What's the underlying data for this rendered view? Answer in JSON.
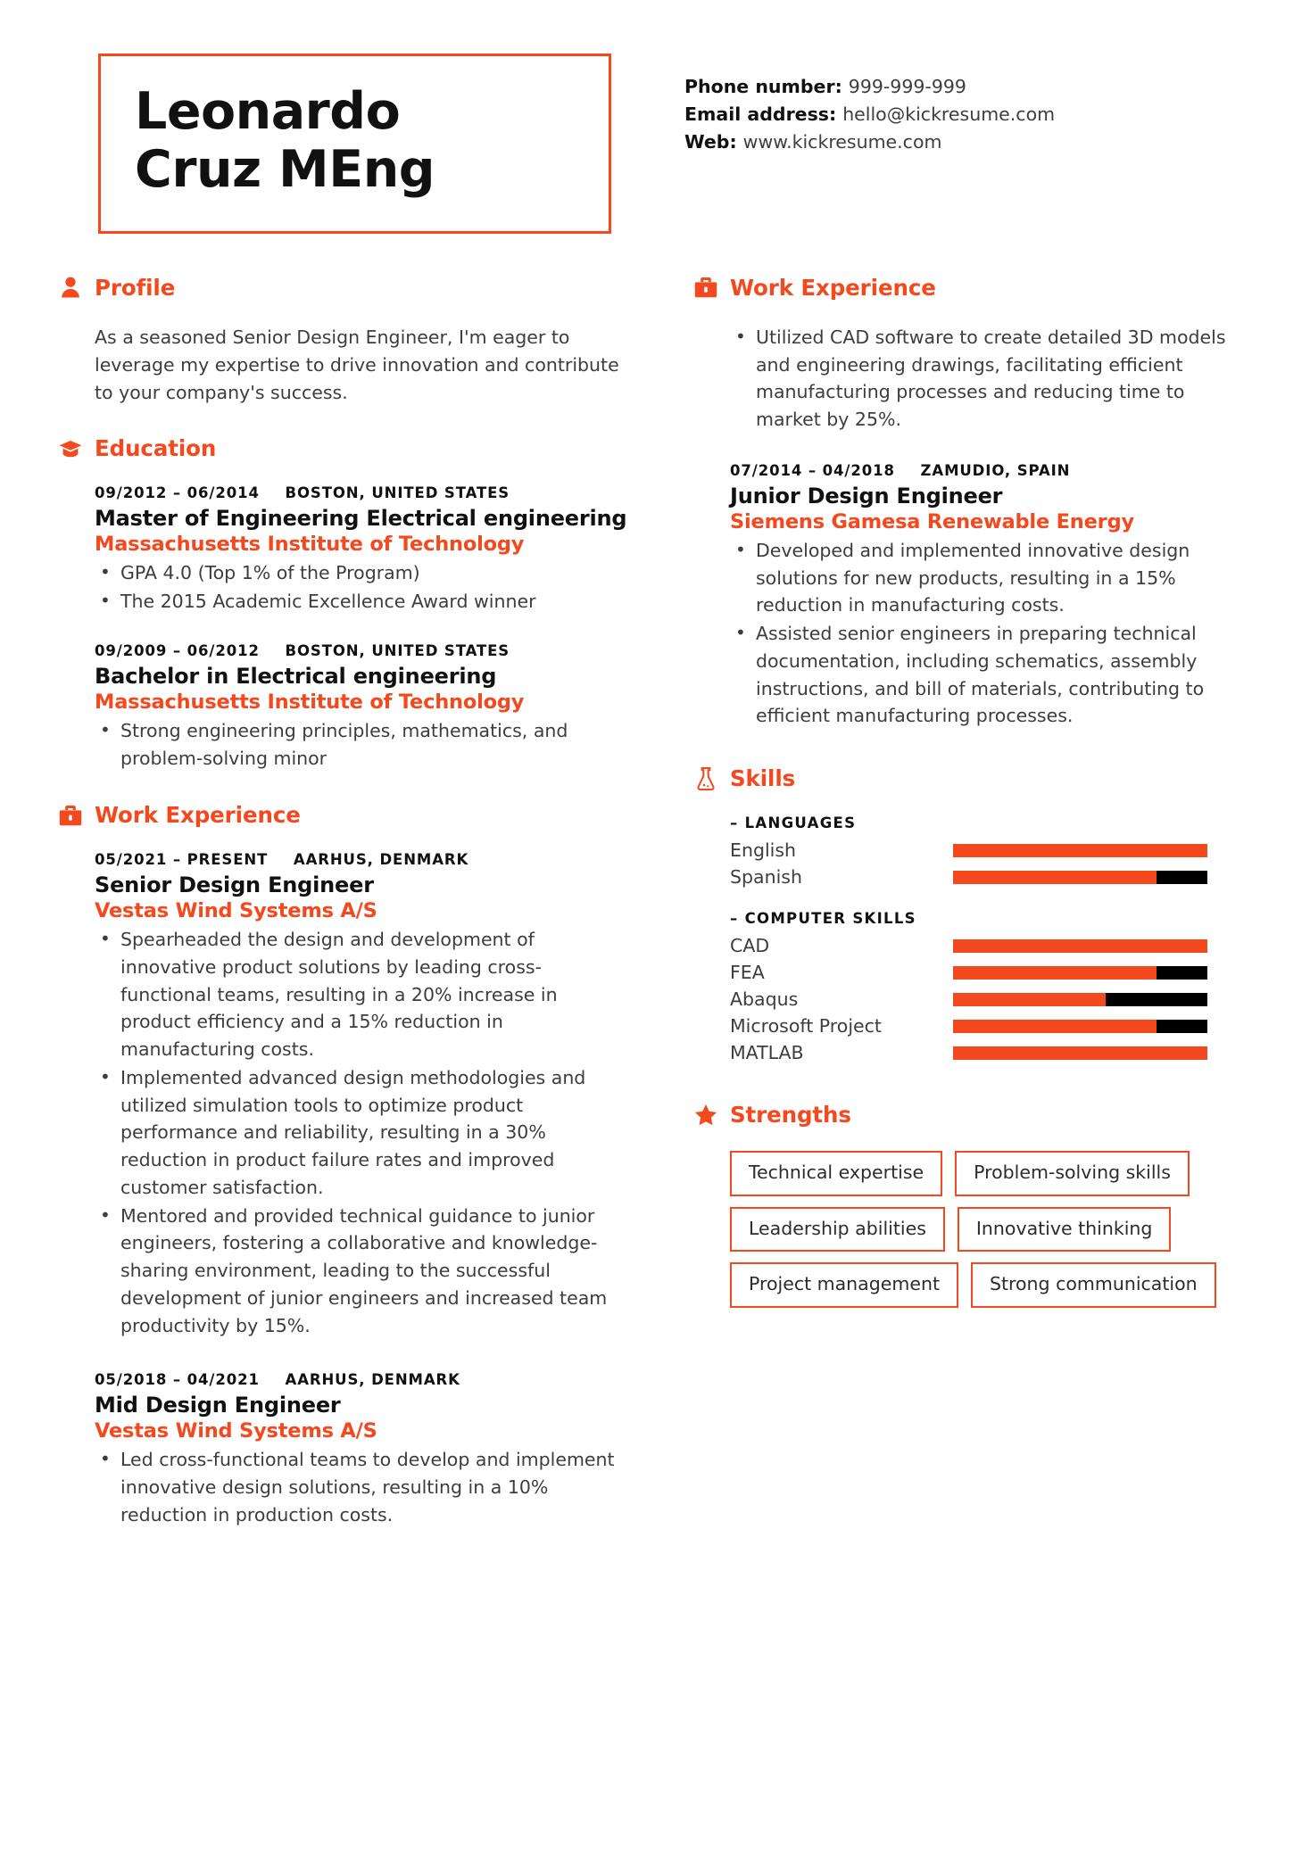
{
  "theme": {
    "accent": "#F4481E",
    "ink": "#111111",
    "body_text": "#3d3d3d",
    "bar_track": "#000000"
  },
  "header": {
    "name_line_1": "Leonardo",
    "name_line_2": "Cruz MEng",
    "contact": [
      {
        "label": "Phone number:",
        "value": "999-999-999"
      },
      {
        "label": "Email address:",
        "value": "hello@kickresume.com"
      },
      {
        "label": "Web:",
        "value": "www.kickresume.com"
      }
    ]
  },
  "left": {
    "profile": {
      "icon": "person-icon",
      "title": "Profile",
      "text": "As a seasoned Senior Design Engineer, I'm eager to leverage my expertise to drive innovation and contribute to your company's success."
    },
    "education": {
      "icon": "graduation-cap-icon",
      "title": "Education",
      "entries": [
        {
          "dates": "09/2012 – 06/2014",
          "location": "BOSTON, UNITED STATES",
          "title": "Master of Engineering Electrical engineering",
          "org": "Massachusetts Institute of Technology",
          "bullets": [
            "GPA 4.0 (Top 1% of the Program)",
            "The 2015 Academic Excellence Award winner"
          ]
        },
        {
          "dates": "09/2009 – 06/2012",
          "location": "BOSTON, UNITED STATES",
          "title": "Bachelor in Electrical engineering",
          "org": "Massachusetts Institute of Technology",
          "bullets": [
            "Strong engineering principles, mathematics, and problem-solving minor"
          ]
        }
      ]
    },
    "work": {
      "icon": "briefcase-icon",
      "title": "Work Experience",
      "entries": [
        {
          "dates": "05/2021 – PRESENT",
          "location": "AARHUS, DENMARK",
          "title": "Senior Design Engineer",
          "org": "Vestas Wind Systems A/S",
          "bullets": [
            "Spearheaded the design and development of innovative product solutions by leading cross-functional teams, resulting in a 20% increase in product efficiency and a 15% reduction in manufacturing costs.",
            "Implemented advanced design methodologies and utilized simulation tools to optimize product performance and reliability, resulting in a 30% reduction in product failure rates and improved customer satisfaction.",
            "Mentored and provided technical guidance to junior engineers, fostering a collaborative and knowledge-sharing environment, leading to the successful development of junior engineers and increased team productivity by 15%."
          ]
        },
        {
          "dates": "05/2018 – 04/2021",
          "location": "AARHUS, DENMARK",
          "title": "Mid Design Engineer",
          "org": "Vestas Wind Systems A/S",
          "bullets": [
            "Led cross-functional teams to develop and implement innovative design solutions, resulting in a 10% reduction in production costs."
          ]
        }
      ]
    }
  },
  "right": {
    "work": {
      "icon": "briefcase-icon",
      "title": "Work Experience",
      "lead_bullets": [
        "Utilized CAD software to create detailed 3D models and engineering drawings, facilitating efficient manufacturing processes and reducing time to market by 25%."
      ],
      "entries": [
        {
          "dates": "07/2014 – 04/2018",
          "location": "ZAMUDIO, SPAIN",
          "title": "Junior Design Engineer",
          "org": "Siemens Gamesa Renewable Energy",
          "bullets": [
            "Developed and implemented innovative design solutions for new products, resulting in a 15% reduction in manufacturing costs.",
            "Assisted senior engineers in preparing technical documentation, including schematics, assembly instructions, and bill of materials, contributing to efficient manufacturing processes."
          ]
        }
      ]
    },
    "skills": {
      "icon": "flask-icon",
      "title": "Skills",
      "groups": [
        {
          "title": "– LANGUAGES",
          "items": [
            {
              "name": "English",
              "level": 100
            },
            {
              "name": "Spanish",
              "level": 80
            }
          ]
        },
        {
          "title": "– COMPUTER SKILLS",
          "items": [
            {
              "name": "CAD",
              "level": 100
            },
            {
              "name": "FEA",
              "level": 80
            },
            {
              "name": "Abaqus",
              "level": 60
            },
            {
              "name": "Microsoft Project",
              "level": 80
            },
            {
              "name": "MATLAB",
              "level": 100
            }
          ]
        }
      ]
    },
    "strengths": {
      "icon": "star-icon",
      "title": "Strengths",
      "tags": [
        "Technical expertise",
        "Problem-solving skills",
        "Leadership abilities",
        "Innovative thinking",
        "Project management",
        "Strong communication"
      ]
    }
  }
}
